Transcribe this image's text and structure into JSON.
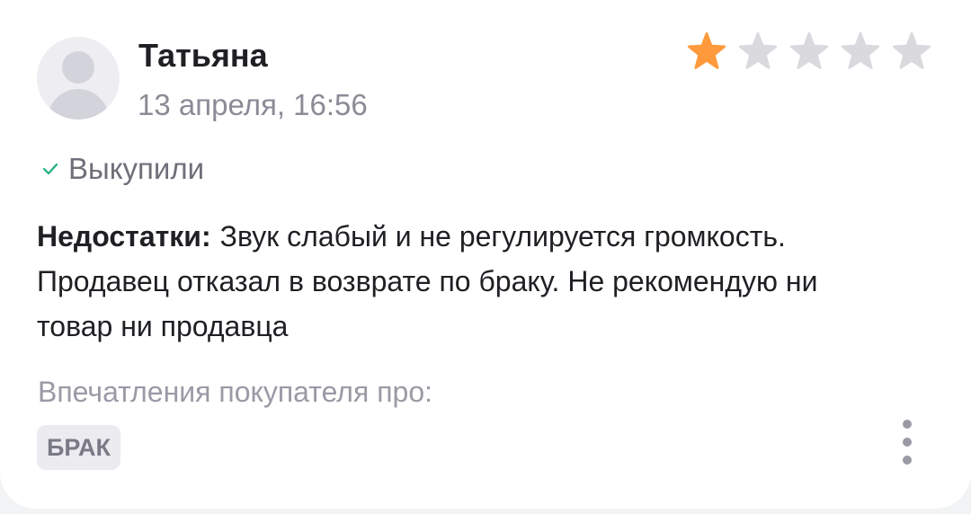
{
  "review": {
    "author": "Татьяна",
    "date": "13 апреля, 16:56",
    "rating": 1,
    "rating_max": 5,
    "star_filled_color": "#ff9a3c",
    "star_empty_color": "#d9d9de",
    "purchased_label": "Выкупили",
    "purchased_icon": "check-icon",
    "cons_label": "Недостатки:",
    "cons_text": "Звук слабый и не регулируется громкость. Продавец отказал в возврате по браку. Не рекомендую ни товар ни продавца",
    "impressions_label": "Впечатления покупателя про:",
    "tags": [
      "БРАК"
    ],
    "more_icon": "more-vertical-icon"
  }
}
